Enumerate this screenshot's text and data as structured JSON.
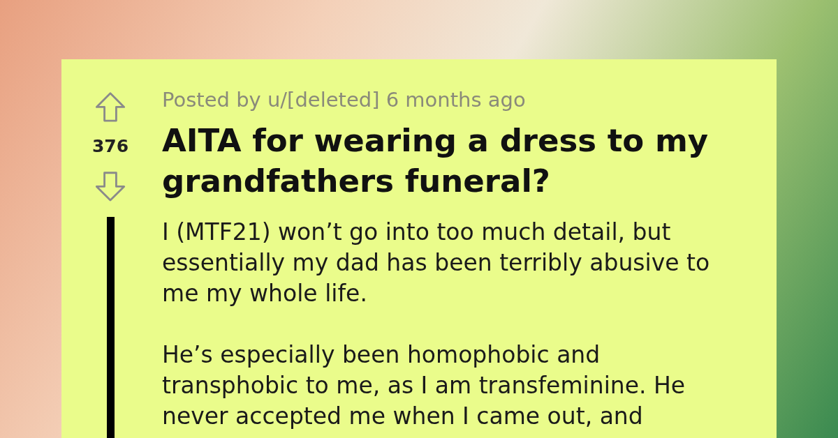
{
  "post": {
    "meta": "Posted by u/[deleted] 6 months ago",
    "score": "376",
    "title": "AITA for wearing a dress to my grandfathers funeral?",
    "paragraphs": [
      "I (MTF21) won’t go into too much detail, but essentially my dad has been terribly abusive to me my whole life.",
      "He’s especially been homophobic and transphobic to me, as I am transfeminine. He never accepted me when I came out, and"
    ]
  }
}
